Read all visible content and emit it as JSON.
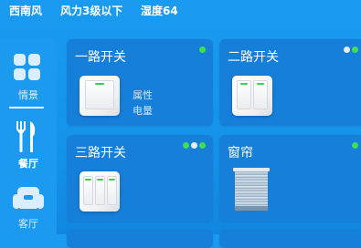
{
  "status_bar": {
    "wind_direction": "西南风",
    "wind_level": "风力3级以下",
    "humidity": "湿度64"
  },
  "sidebar": {
    "items": [
      {
        "label": "情景",
        "icon": "scene-grid-icon",
        "active": false
      },
      {
        "label": "餐厅",
        "icon": "fork-knife-icon",
        "active": true
      },
      {
        "label": "客厅",
        "icon": "sofa-icon",
        "active": false
      }
    ]
  },
  "devices": [
    {
      "title": "一路开关",
      "icon": "one-gang-switch-icon",
      "status": [
        "#3fe04f"
      ],
      "props": [
        "属性",
        "电量"
      ]
    },
    {
      "title": "二路开关",
      "icon": "two-gang-switch-icon",
      "status": [
        "#e8eef5",
        "#3fe04f"
      ]
    },
    {
      "title": "三路开关",
      "icon": "three-gang-switch-icon",
      "status": [
        "#3fe04f",
        "#e8eef5",
        "#3fe04f"
      ]
    },
    {
      "title": "窗帘",
      "icon": "curtain-icon",
      "status": [
        "#3fe04f"
      ]
    }
  ],
  "colors": {
    "background": "#1593ea",
    "card": "#167fd9",
    "online_led": "#3fe04f",
    "offline_led": "#e8eef5"
  }
}
